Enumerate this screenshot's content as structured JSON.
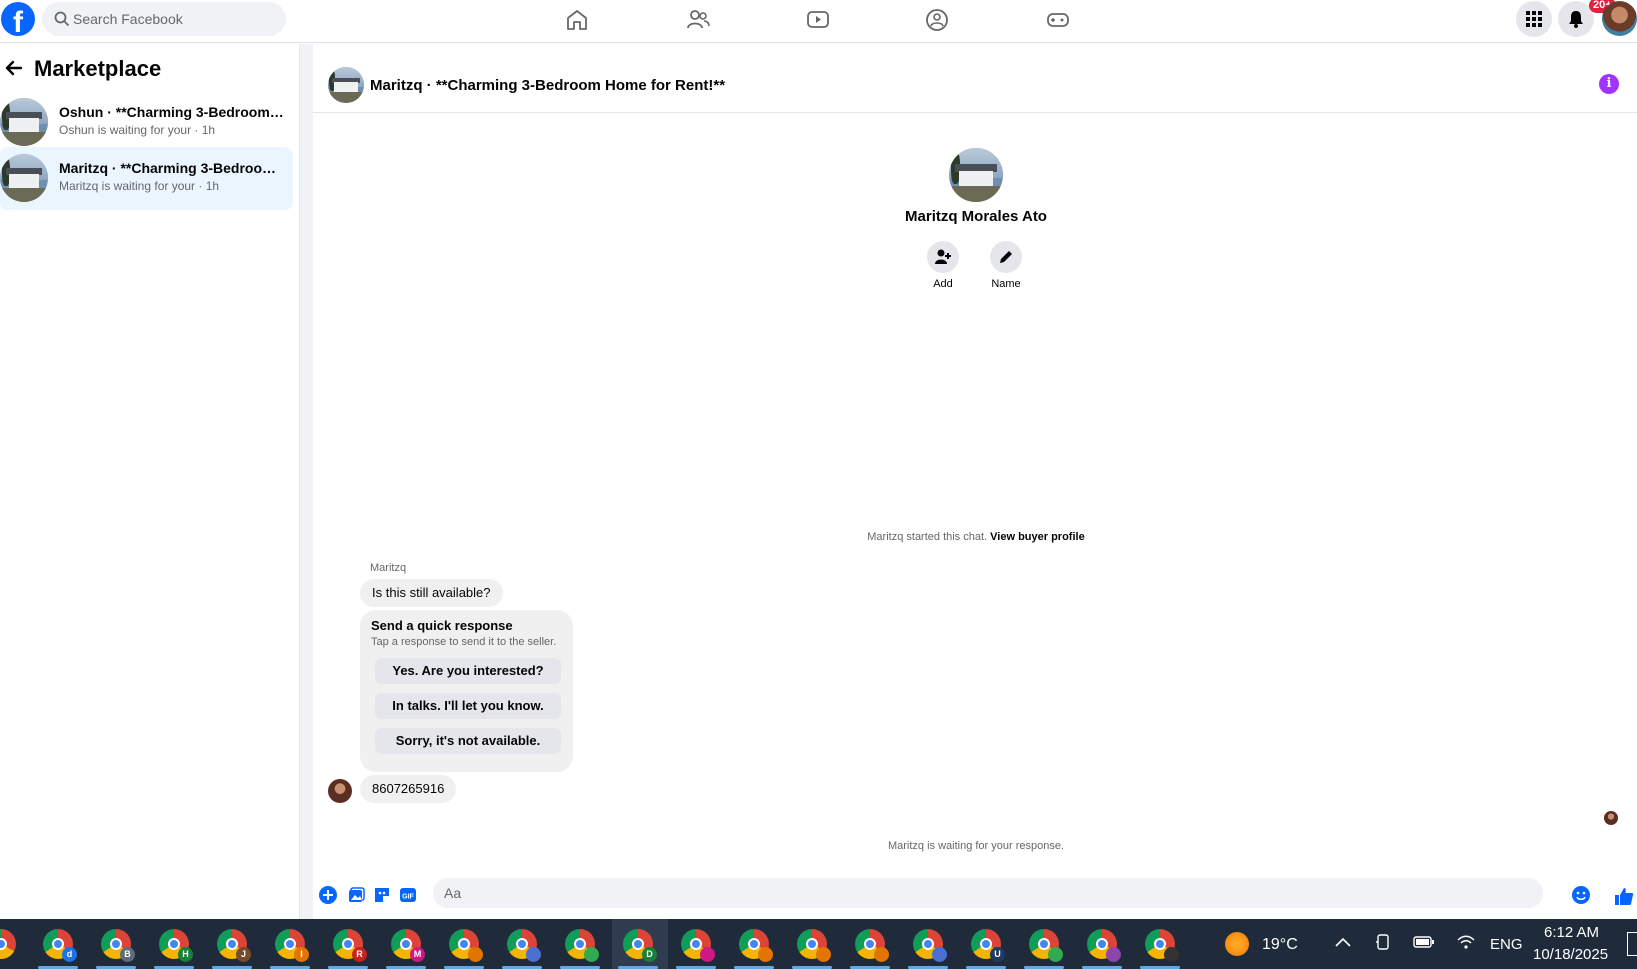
{
  "topbar": {
    "search_placeholder": "Search Facebook",
    "notification_badge": "20+",
    "nav_icons": [
      "home-icon",
      "friends-icon",
      "video-icon",
      "groups-icon",
      "gaming-icon"
    ]
  },
  "sidebar": {
    "title": "Marketplace",
    "conversations": [
      {
        "name": "Oshun · **Charming 3-Bedroom H...",
        "subtitle": "Oshun is waiting for your · 1h",
        "active": false
      },
      {
        "name": "Maritzq · **Charming 3-Bedroom ...",
        "subtitle": "Maritzq is waiting for your · 1h",
        "active": true
      }
    ]
  },
  "chat": {
    "header_title": "Maritzq · **Charming 3-Bedroom Home for Rent!**",
    "profile_name": "Maritzq Morales Ato",
    "actions": {
      "add": "Add",
      "name": "Name"
    },
    "system_message": "Maritzq started this chat.",
    "system_link": "View buyer profile",
    "sender_name": "Maritzq",
    "first_message": "Is this still available?",
    "quick_response": {
      "title": "Send a quick response",
      "subtitle": "Tap a response to send it to the seller.",
      "options": [
        "Yes. Are you interested?",
        "In talks. I'll let you know.",
        "Sorry, it's not available."
      ]
    },
    "second_message": "8607265916",
    "waiting_message": "Maritzq is waiting for your response.",
    "composer_placeholder": "Aa",
    "accent_color": "#0866ff",
    "info_color": "#a033ff"
  },
  "taskbar": {
    "weather_temp": "19°C",
    "language": "ENG",
    "time": "6:12 AM",
    "date": "10/18/2025",
    "app_letters": [
      "d",
      "B",
      "H",
      "J",
      "I",
      "R",
      "M",
      "",
      "",
      "",
      "D",
      "",
      "",
      "",
      "",
      "",
      "U",
      "",
      "",
      ""
    ]
  }
}
